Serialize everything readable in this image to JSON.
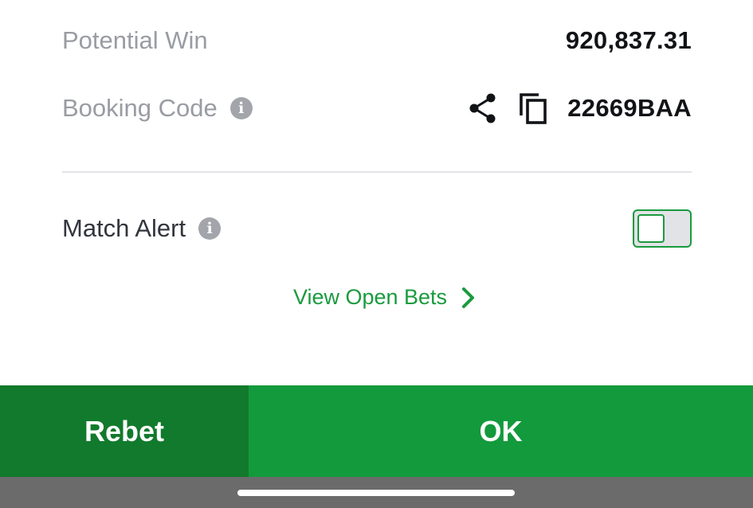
{
  "summary": {
    "potential_win_label": "Potential Win",
    "potential_win_value": "920,837.31",
    "booking_code_label": "Booking Code",
    "booking_code_value": "22669BAA"
  },
  "alerts": {
    "match_alert_label": "Match Alert",
    "match_alert_on": false
  },
  "links": {
    "view_open_bets": "View Open Bets"
  },
  "actions": {
    "rebet_label": "Rebet",
    "ok_label": "OK"
  },
  "icons": {
    "info": "info-icon",
    "share": "share-icon",
    "copy": "copy-icon",
    "chevron": "chevron-right-icon"
  },
  "colors": {
    "accent_green": "#139a3c",
    "dark_green": "#117a2c",
    "muted_text": "#9a9ca3"
  }
}
